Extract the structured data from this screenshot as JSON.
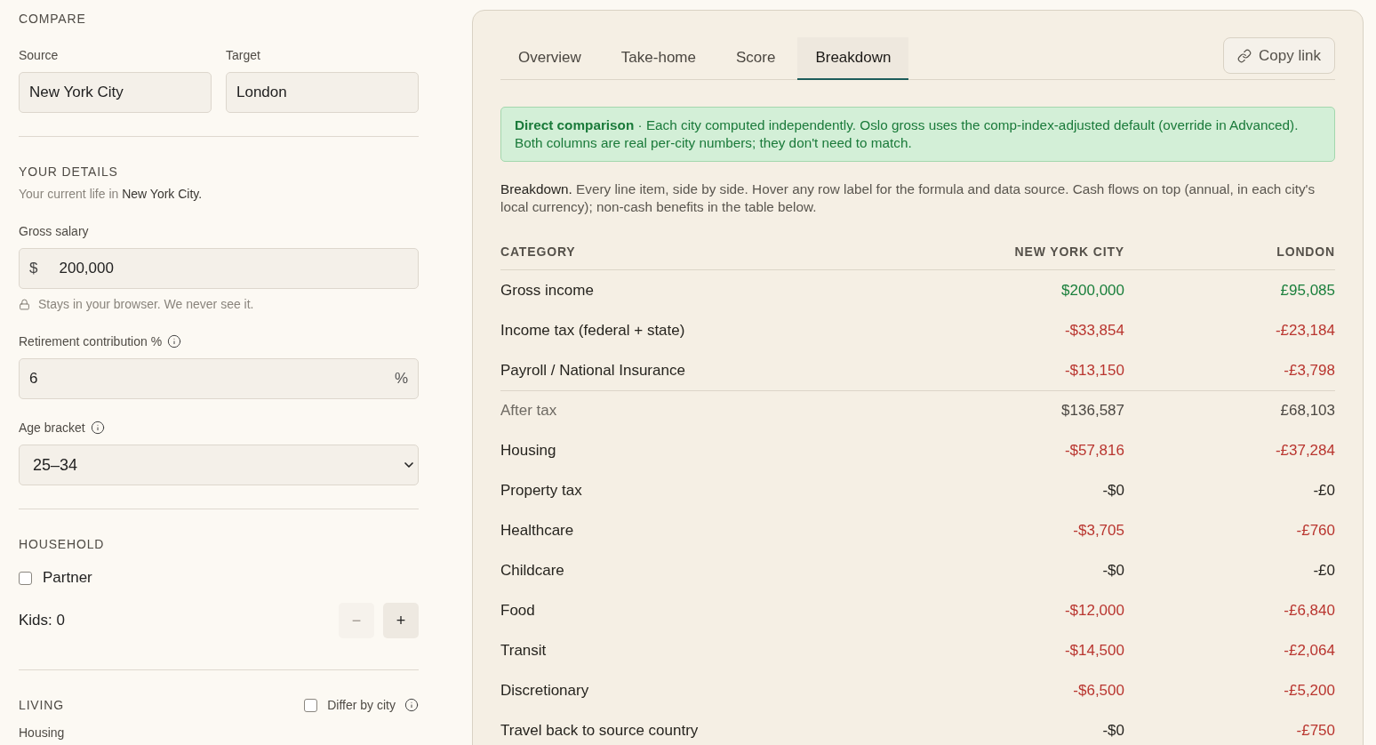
{
  "sidebar": {
    "compare": {
      "heading": "COMPARE",
      "source": {
        "label": "Source",
        "value": "New York City"
      },
      "target": {
        "label": "Target",
        "value": "London"
      }
    },
    "details": {
      "heading": "YOUR DETAILS",
      "subtitle": "Your current life in **New York City.**",
      "gross_salary": {
        "label": "Gross salary",
        "prefix": "$",
        "value": "200,000",
        "note": "Stays in your browser. We never see it."
      },
      "retirement": {
        "label": "Retirement contribution %",
        "value": "6",
        "suffix": "%"
      },
      "age_bracket": {
        "label": "Age bracket",
        "value": "25–34"
      }
    },
    "household": {
      "heading": "HOUSEHOLD",
      "partner": {
        "label": "Partner",
        "checked": false
      },
      "kids": {
        "label": "Kids: 0",
        "buttons": [
          {
            "symbol": "−",
            "disabled": true
          },
          {
            "symbol": "+",
            "disabled": false
          }
        ]
      }
    },
    "living": {
      "heading": "LIVING",
      "differ_by_city": {
        "label": "Differ by city",
        "checked": false
      },
      "field_label": "Housing"
    }
  },
  "panel": {
    "tabs": [
      {
        "label": "Overview",
        "selected": false
      },
      {
        "label": "Take-home",
        "selected": false
      },
      {
        "label": "Score",
        "selected": false
      },
      {
        "label": "Breakdown",
        "selected": true
      }
    ],
    "copy_link": {
      "label": "Copy link"
    },
    "banner": "**Direct comparison** · Each city computed independently. Oslo gross uses the comp-index-adjusted default (override in Advanced). Both columns are real per-city numbers; they don't need to match.",
    "description": "**Breakdown.** Every line item, side by side. Hover any row label for the formula and data source. Cash flows on top (annual, in each city's local currency); non-cash benefits in the table below.",
    "table": {
      "columns": [
        "CATEGORY",
        "NEW YORK CITY",
        "LONDON"
      ],
      "rows": [
        {
          "label": "Gross income",
          "kind": "line",
          "values": [
            {
              "text": "$200,000",
              "color": "#1a7f3c"
            },
            {
              "text": "£95,085",
              "color": "#1a7f3c"
            }
          ]
        },
        {
          "label": "Income tax (federal + state)",
          "kind": "line",
          "values": [
            {
              "text": "-$33,854",
              "color": "#b9352f"
            },
            {
              "text": "-£23,184",
              "color": "#b9352f"
            }
          ]
        },
        {
          "label": "Payroll / National Insurance",
          "kind": "line",
          "values": [
            {
              "text": "-$13,150",
              "color": "#b9352f"
            },
            {
              "text": "-£3,798",
              "color": "#b9352f"
            }
          ]
        },
        {
          "label": "After tax",
          "kind": "subtotal",
          "values": [
            {
              "text": "$136,587",
              "color": "#4c4843"
            },
            {
              "text": "£68,103",
              "color": "#4c4843"
            }
          ]
        },
        {
          "label": "Housing",
          "kind": "line",
          "values": [
            {
              "text": "-$57,816",
              "color": "#b9352f"
            },
            {
              "text": "-£37,284",
              "color": "#b9352f"
            }
          ]
        },
        {
          "label": "Property tax",
          "kind": "line",
          "values": [
            {
              "text": "-$0",
              "color": "#262420"
            },
            {
              "text": "-£0",
              "color": "#262420"
            }
          ]
        },
        {
          "label": "Healthcare",
          "kind": "line",
          "values": [
            {
              "text": "-$3,705",
              "color": "#b9352f"
            },
            {
              "text": "-£760",
              "color": "#b9352f"
            }
          ]
        },
        {
          "label": "Childcare",
          "kind": "line",
          "values": [
            {
              "text": "-$0",
              "color": "#262420"
            },
            {
              "text": "-£0",
              "color": "#262420"
            }
          ]
        },
        {
          "label": "Food",
          "kind": "line",
          "values": [
            {
              "text": "-$12,000",
              "color": "#b9352f"
            },
            {
              "text": "-£6,840",
              "color": "#b9352f"
            }
          ]
        },
        {
          "label": "Transit",
          "kind": "line",
          "values": [
            {
              "text": "-$14,500",
              "color": "#b9352f"
            },
            {
              "text": "-£2,064",
              "color": "#b9352f"
            }
          ]
        },
        {
          "label": "Discretionary",
          "kind": "line",
          "values": [
            {
              "text": "-$6,500",
              "color": "#b9352f"
            },
            {
              "text": "-£5,200",
              "color": "#b9352f"
            }
          ]
        },
        {
          "label": "Travel back to source country",
          "kind": "line",
          "values": [
            {
              "text": "-$0",
              "color": "#262420"
            },
            {
              "text": "-£750",
              "color": "#b9352f"
            }
          ]
        }
      ]
    }
  }
}
